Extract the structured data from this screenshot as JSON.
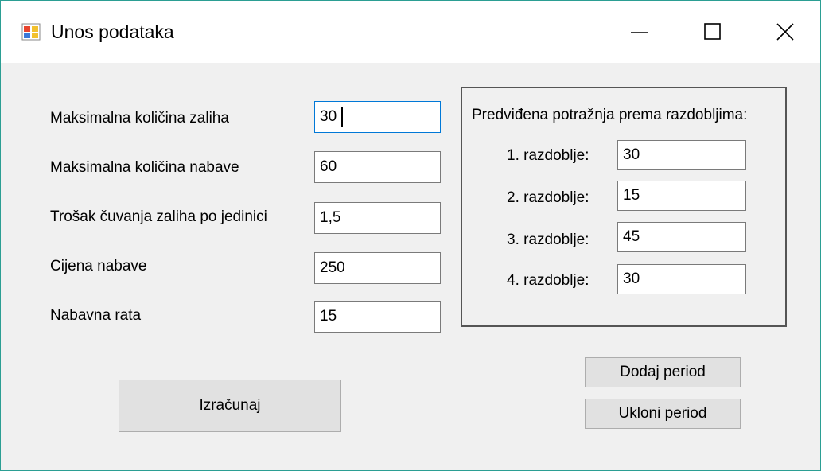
{
  "window": {
    "title": "Unos podataka",
    "controls": {
      "minimize": "minimize-icon",
      "maximize": "maximize-icon",
      "close": "close-icon"
    },
    "accent_border_color": "#2b9e93"
  },
  "left_form": {
    "fields": [
      {
        "label": "Maksimalna količina zaliha",
        "value": "30"
      },
      {
        "label": "Maksimalna količina nabave",
        "value": "60"
      },
      {
        "label": "Trošak čuvanja zaliha po jedinici",
        "value": "1,5"
      },
      {
        "label": "Cijena nabave",
        "value": "250"
      },
      {
        "label": "Nabavna rata",
        "value": "15"
      }
    ],
    "calculate_button": "Izračunaj"
  },
  "demand_group": {
    "heading": "Predviđena potražnja prema razdobljima:",
    "periods": [
      {
        "label": "1. razdoblje:",
        "value": "30"
      },
      {
        "label": "2. razdoblje:",
        "value": "15"
      },
      {
        "label": "3. razdoblje:",
        "value": "45"
      },
      {
        "label": "4. razdoblje:",
        "value": "30"
      }
    ]
  },
  "buttons": {
    "add_period": "Dodaj period",
    "remove_period": "Ukloni period"
  }
}
